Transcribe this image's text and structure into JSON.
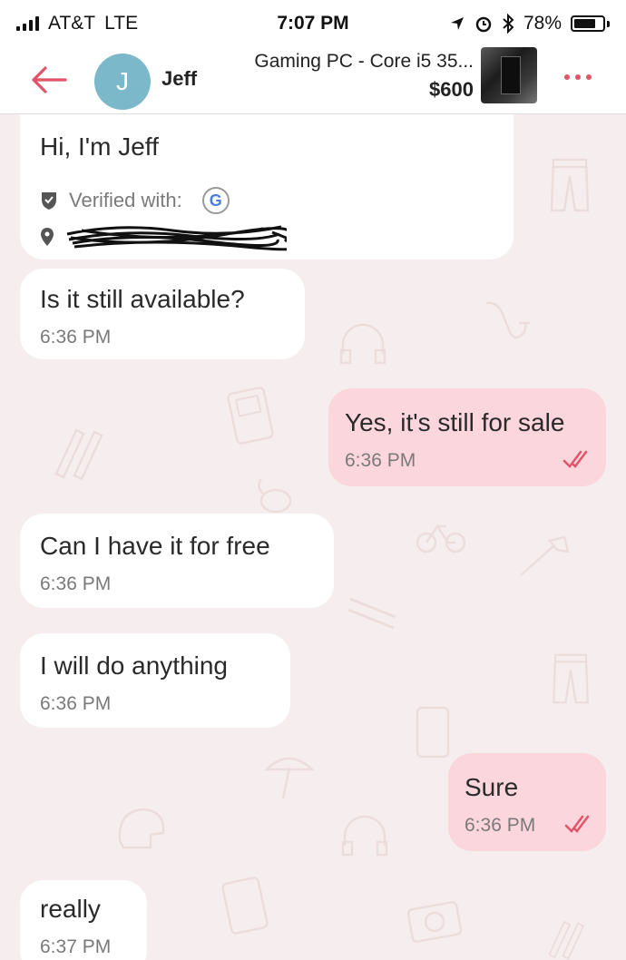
{
  "status_bar": {
    "carrier": "AT&T",
    "network": "LTE",
    "time": "7:07 PM",
    "battery": "78%",
    "battery_level": 0.78
  },
  "header": {
    "avatar_initial": "J",
    "contact_name": "Jeff",
    "listing_title": "Gaming PC - Core i5 35...",
    "listing_price": "$600"
  },
  "profile_card": {
    "greeting": "Hi, I'm Jeff",
    "verified_label": "Verified with:",
    "verified_provider": "G"
  },
  "messages": [
    {
      "text": "Is it still available?",
      "time": "6:36 PM",
      "direction": "in"
    },
    {
      "text": "Yes, it's still for sale",
      "time": "6:36 PM",
      "direction": "out"
    },
    {
      "text": "Can I have it for free",
      "time": "6:36 PM",
      "direction": "in"
    },
    {
      "text": "I will do anything",
      "time": "6:36 PM",
      "direction": "in"
    },
    {
      "text": "Sure",
      "time": "6:36 PM",
      "direction": "out"
    },
    {
      "text": "really",
      "time": "6:37 PM",
      "direction": "in"
    }
  ],
  "colors": {
    "accent": "#e0546a",
    "outgoing_bubble": "#fbd6dc",
    "incoming_bubble": "#ffffff",
    "chat_background": "#f6eeee",
    "avatar": "#7bb8c9"
  }
}
